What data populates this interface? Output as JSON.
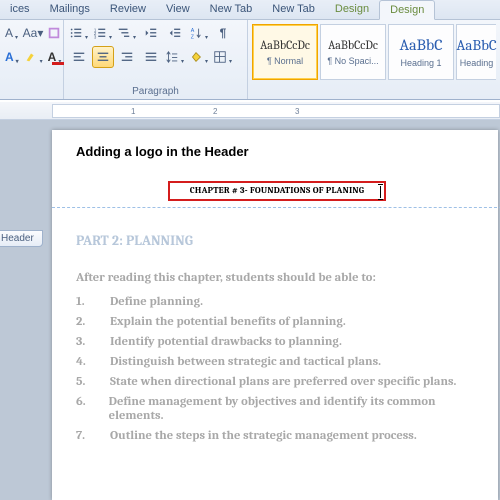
{
  "tabs": {
    "t0": "ices",
    "t1": "Mailings",
    "t2": "Review",
    "t3": "View",
    "t4": "New Tab",
    "t5": "New Tab",
    "t6": "Design",
    "t7": "Design"
  },
  "groups": {
    "font_label": "",
    "paragraph_label": "Paragraph",
    "styles_label": ""
  },
  "styles": {
    "s0": {
      "preview": "AaBbCcDc",
      "name": "¶ Normal"
    },
    "s1": {
      "preview": "AaBbCcDc",
      "name": "¶ No Spaci..."
    },
    "s2": {
      "preview": "AaBbC",
      "name": "Heading 1"
    },
    "s3": {
      "preview": "AaBbC",
      "name": "Heading"
    }
  },
  "doc": {
    "tutorial_title": "Adding a logo in the Header",
    "header_text": "CHAPTER # 3- FOUNDATIONS OF PLANING",
    "header_tag": "Header",
    "part_title": "PART 2: PLANNING",
    "intro": "After reading this chapter, students should be able to:",
    "items": [
      "Define planning.",
      "Explain the potential benefits of planning.",
      "Identify potential drawbacks to planning.",
      "Distinguish between strategic and tactical plans.",
      "State when directional plans are preferred over specific plans.",
      "Define management by objectives and identify its common elements.",
      "Outline the steps in the strategic management process."
    ],
    "nums": [
      "1.",
      "2.",
      "3.",
      "4.",
      "5.",
      "6.",
      "7."
    ]
  },
  "ruler": {
    "n1": "1",
    "n2": "2",
    "n3": "3"
  }
}
